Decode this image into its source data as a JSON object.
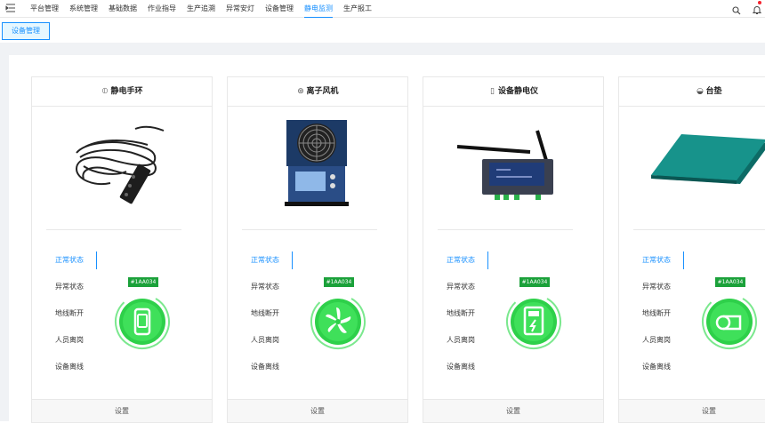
{
  "nav": {
    "items": [
      "平台管理",
      "系统管理",
      "基础数据",
      "作业指导",
      "生产追溯",
      "异常安灯",
      "设备管理",
      "静电监测",
      "生产报工"
    ],
    "active_index": 7
  },
  "breadcrumb": {
    "tab_label": "设备管理"
  },
  "colors": {
    "accent": "#1890ff",
    "ok_green": "#1ba13a",
    "gauge_green": "#2ed04a"
  },
  "status_labels": [
    "正常状态",
    "异常状态",
    "地线断开",
    "人员离岗",
    "设备离线"
  ],
  "cards": [
    {
      "title": "静电手环",
      "header_icon": "wristband-icon",
      "device_tag": "#1AA034",
      "status_icon": "watch-icon",
      "active_status": "正常状态",
      "footer": "设置"
    },
    {
      "title": "离子风机",
      "header_icon": "fan-icon",
      "device_tag": "#1AA034",
      "status_icon": "fan-icon",
      "active_status": "正常状态",
      "footer": "设置"
    },
    {
      "title": "设备静电仪",
      "header_icon": "meter-icon",
      "device_tag": "#1AA034",
      "status_icon": "meter-icon",
      "active_status": "正常状态",
      "footer": "设置"
    },
    {
      "title": "台垫",
      "header_icon": "mat-icon",
      "device_tag": "#1AA034",
      "status_icon": "mat-icon",
      "active_status": "正常状态",
      "footer": "设置"
    }
  ]
}
